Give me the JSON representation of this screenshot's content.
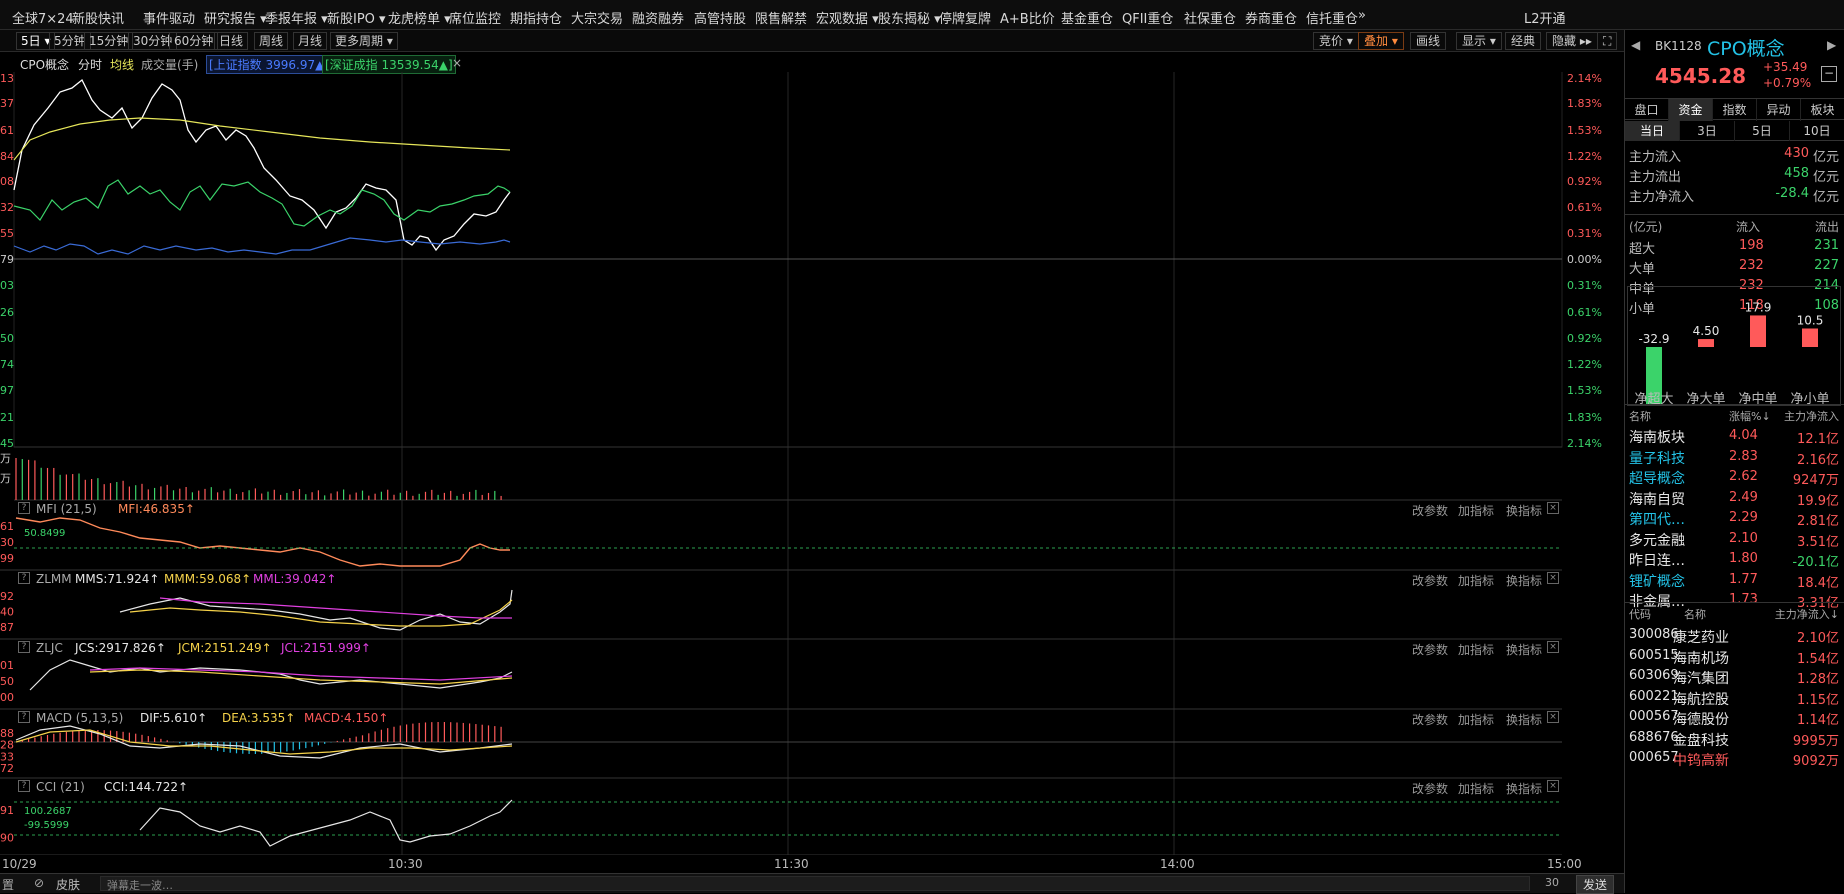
{
  "topnav": [
    "全球7×24",
    "新股快讯",
    "事件驱动",
    "研究报告 ▾",
    "季报年报 ▾",
    "新股IPO ▾",
    "龙虎榜单 ▾",
    "席位监控",
    "期指持仓",
    "大宗交易",
    "融资融券",
    "高管持股",
    "限售解禁",
    "宏观数据 ▾",
    "股东揭秘 ▾",
    "停牌复牌",
    "A+B比价",
    "基金重仓",
    "QFII重仓",
    "社保重仓",
    "券商重仓",
    "信托重仓",
    "»",
    "L2开通"
  ],
  "periods": [
    "5日 ▾",
    "5分钟",
    "15分钟",
    "30分钟",
    "60分钟",
    "日线",
    "周线",
    "月线",
    "更多周期 ▾"
  ],
  "toolbar_right": [
    "竞价 ▾",
    "叠加 ▾",
    "画线",
    "显示 ▾",
    "经典",
    "隐藏 ▸▸",
    "⛶"
  ],
  "legend": {
    "name": "CPO概念",
    "timeshare": "分时",
    "avg": "均线",
    "vol": "成交量(手)",
    "sh_index": "[上证指数 3996.97▲]",
    "sz_index": "[深证成指 13539.54▲]",
    "close": "×"
  },
  "main_chart": {
    "left_ticks": [
      "13",
      "37",
      "61",
      "84",
      "08",
      "32",
      "55",
      "79",
      "03",
      "26",
      "50",
      "74",
      "97",
      "21",
      "45"
    ],
    "right_ticks": [
      "2.14%",
      "1.83%",
      "1.53%",
      "1.22%",
      "0.92%",
      "0.61%",
      "0.31%",
      "0.00%",
      "0.31%",
      "0.61%",
      "0.92%",
      "1.22%",
      "1.53%",
      "1.83%",
      "2.14%"
    ],
    "vol_ticks": [
      "万",
      "万"
    ],
    "colors": {
      "price": "#ffffff",
      "avg": "#e6e65a",
      "green_line": "#3bd36a",
      "blue_line": "#3a6bd6",
      "up": "#ff5a5a",
      "down": "#3bd36a"
    }
  },
  "panels": [
    {
      "id": "mfi",
      "title": "MFI (21,5)",
      "values": [
        {
          "label": "MFI:46.835↑",
          "color": "#ff8a5a"
        }
      ],
      "ticks": [
        "61",
        "30",
        "99"
      ],
      "ref_labels": [
        "50.8499"
      ]
    },
    {
      "id": "zlmm",
      "title": "ZLMM",
      "values": [
        {
          "label": "MMS:71.924↑",
          "color": "#e6e6e6"
        },
        {
          "label": "MMM:59.068↑",
          "color": "#f5d24a"
        },
        {
          "label": "MML:39.042↑",
          "color": "#e040e0"
        }
      ],
      "ticks": [
        "92",
        "40",
        "87"
      ],
      "ref_labels": []
    },
    {
      "id": "zljc",
      "title": "ZLJC",
      "values": [
        {
          "label": "JCS:2917.826↑",
          "color": "#e6e6e6"
        },
        {
          "label": "JCM:2151.249↑",
          "color": "#f5d24a"
        },
        {
          "label": "JCL:2151.999↑",
          "color": "#e040e0"
        }
      ],
      "ticks": [
        "01",
        "50",
        "00"
      ],
      "ref_labels": []
    },
    {
      "id": "macd",
      "title": "MACD (5,13,5)",
      "values": [
        {
          "label": "DIF:5.610↑",
          "color": "#e6e6e6"
        },
        {
          "label": "DEA:3.535↑",
          "color": "#f5d24a"
        },
        {
          "label": "MACD:4.150↑",
          "color": "#ff5a5a"
        }
      ],
      "ticks": [
        "88",
        "28",
        "33",
        "72"
      ],
      "ref_labels": []
    },
    {
      "id": "cci",
      "title": "CCI (21)",
      "values": [
        {
          "label": "CCI:144.722↑",
          "color": "#e6e6e6"
        }
      ],
      "ticks": [
        "91",
        "90"
      ],
      "ref_labels": [
        "100.2687",
        "-99.5999"
      ]
    }
  ],
  "panel_actions": [
    "改参数",
    "加指标",
    "换指标"
  ],
  "time_axis": [
    "10/29",
    "10:30",
    "11:30",
    "14:00",
    "15:00"
  ],
  "bottombar": {
    "settings": "置",
    "skin_icon": "skin-icon",
    "skin": "皮肤",
    "danmu_placeholder": "弹幕走一波…",
    "count": "30",
    "send": "发送"
  },
  "quote": {
    "code": "BK1128",
    "name": "CPO概念",
    "price": "4545.28",
    "change": "+35.49",
    "pct": "+0.79%"
  },
  "tabs": [
    "盘口",
    "资金",
    "指数",
    "异动",
    "板块"
  ],
  "subtabs": [
    "当日",
    "3日",
    "5日",
    "10日"
  ],
  "flows": [
    {
      "label": "主力流入",
      "value": "430",
      "unit": "亿元",
      "color": "red"
    },
    {
      "label": "主力流出",
      "value": "458",
      "unit": "亿元",
      "color": "green"
    },
    {
      "label": "主力净流入",
      "value": "-28.4",
      "unit": "亿元",
      "color": "green"
    }
  ],
  "flow_table": {
    "headers": [
      "(亿元)",
      "流入",
      "流出"
    ],
    "rows": [
      {
        "label": "超大",
        "in": "198",
        "out": "231"
      },
      {
        "label": "大单",
        "in": "232",
        "out": "227"
      },
      {
        "label": "中单",
        "in": "232",
        "out": "214"
      },
      {
        "label": "小单",
        "in": "118",
        "out": "108"
      }
    ]
  },
  "net_bars": {
    "values": [
      -32.9,
      4.5,
      17.9,
      10.5
    ],
    "labels": [
      "-32.9",
      "4.50",
      "17.9",
      "10.5"
    ],
    "names": [
      "净超大",
      "净大单",
      "净中单",
      "净小单"
    ]
  },
  "sector_list": {
    "headers": [
      "名称",
      "涨幅%↓",
      "主力净流入"
    ],
    "rows": [
      {
        "name": "海南板块",
        "pct": "4.04",
        "flow": "12.1亿",
        "name_color": "white",
        "flow_color": "red"
      },
      {
        "name": "量子科技",
        "pct": "2.83",
        "flow": "2.16亿",
        "name_color": "cyan",
        "flow_color": "red"
      },
      {
        "name": "超导概念",
        "pct": "2.62",
        "flow": "9247万",
        "name_color": "cyan",
        "flow_color": "red"
      },
      {
        "name": "海南自贸",
        "pct": "2.49",
        "flow": "19.9亿",
        "name_color": "white",
        "flow_color": "red"
      },
      {
        "name": "第四代…",
        "pct": "2.29",
        "flow": "2.81亿",
        "name_color": "cyan",
        "flow_color": "red"
      },
      {
        "name": "多元金融",
        "pct": "2.10",
        "flow": "3.51亿",
        "name_color": "white",
        "flow_color": "red"
      },
      {
        "name": "昨日连…",
        "pct": "1.80",
        "flow": "-20.1亿",
        "name_color": "white",
        "flow_color": "green"
      },
      {
        "name": "锂矿概念",
        "pct": "1.77",
        "flow": "18.4亿",
        "name_color": "cyan",
        "flow_color": "red"
      },
      {
        "name": "非金属…",
        "pct": "1.73",
        "flow": "3.31亿",
        "name_color": "white",
        "flow_color": "red"
      }
    ]
  },
  "stock_list": {
    "headers": [
      "代码",
      "名称",
      "主力净流入↓"
    ],
    "rows": [
      {
        "code": "300086",
        "name": "康芝药业",
        "flow": "2.10亿",
        "name_color": "white"
      },
      {
        "code": "600515",
        "name": "海南机场",
        "flow": "1.54亿",
        "name_color": "white"
      },
      {
        "code": "603069",
        "name": "海汽集团",
        "flow": "1.28亿",
        "name_color": "white"
      },
      {
        "code": "600221",
        "name": "海航控股",
        "flow": "1.15亿",
        "name_color": "white"
      },
      {
        "code": "000567",
        "name": "海德股份",
        "flow": "1.14亿",
        "name_color": "white"
      },
      {
        "code": "688676",
        "name": "金盘科技",
        "flow": "9995万",
        "name_color": "white"
      },
      {
        "code": "000657",
        "name": "中钨高新",
        "flow": "9092万",
        "name_color": "red"
      }
    ]
  }
}
